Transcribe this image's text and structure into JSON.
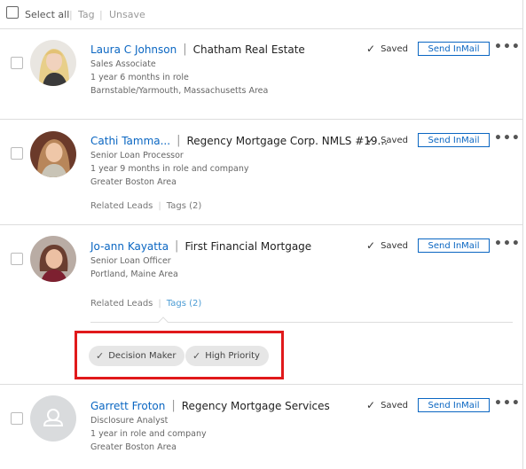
{
  "toolbar": {
    "select_all": "Select all",
    "tag": "Tag",
    "unsave": "Unsave"
  },
  "leads": [
    {
      "name": "Laura C Johnson",
      "company": "Chatham Real Estate",
      "title": "Sales Associate",
      "tenure": "1 year 6 months in role",
      "location": "Barnstable/Yarmouth, Massachusetts Area",
      "saved": "Saved",
      "inmail": "Send InMail",
      "more": "•••"
    },
    {
      "name": "Cathi Tamma...",
      "company": "Regency Mortgage Corp. NMLS #19...",
      "title": "Senior Loan Processor",
      "tenure": "1 year 9 months in role and company",
      "location": "Greater Boston Area",
      "related": "Related Leads",
      "tags": "Tags (2)",
      "saved": "Saved",
      "inmail": "Send InMail",
      "more": "•••"
    },
    {
      "name": "Jo-ann Kayatta",
      "company": "First Financial Mortgage",
      "title": "Senior Loan Officer",
      "location": "Portland, Maine Area",
      "related": "Related Leads",
      "tags": "Tags (2)",
      "tag_pills": [
        "Decision Maker",
        "High Priority"
      ],
      "saved": "Saved",
      "inmail": "Send InMail",
      "more": "•••"
    },
    {
      "name": "Garrett Froton",
      "company": "Regency Mortgage Services",
      "title": "Disclosure Analyst",
      "tenure": "1 year in role and company",
      "location": "Greater Boston Area",
      "saved": "Saved",
      "inmail": "Send InMail",
      "more": "•••"
    }
  ],
  "colors": {
    "link": "#0a66c2",
    "highlight": "#e0191b",
    "pill_bg": "#e6e6e6"
  }
}
